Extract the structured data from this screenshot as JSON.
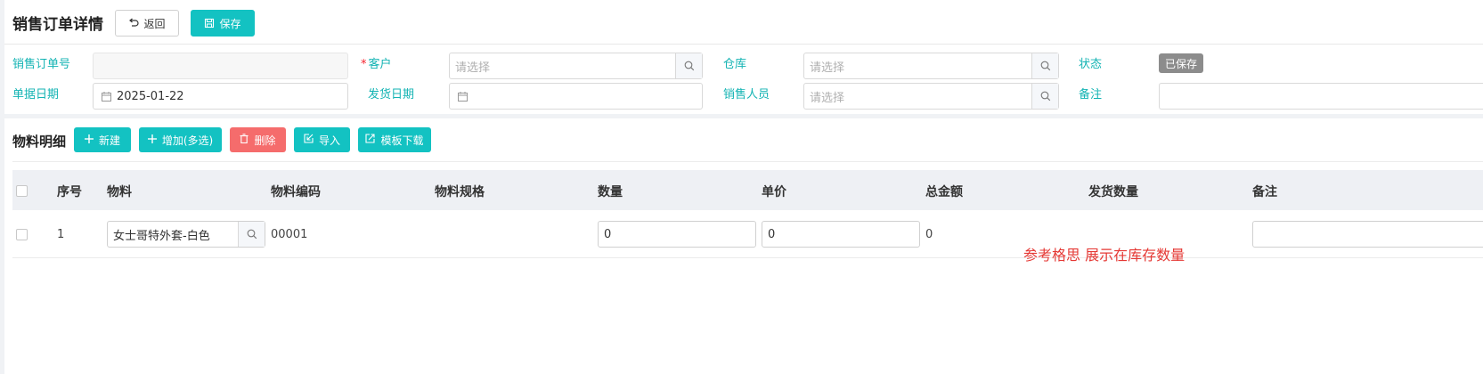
{
  "header": {
    "title": "销售订单详情",
    "back_label": "返回",
    "save_label": "保存"
  },
  "form": {
    "order_no": {
      "label": "销售订单号",
      "value": ""
    },
    "customer": {
      "label": "客户",
      "required_mark": "*",
      "placeholder": "请选择"
    },
    "warehouse": {
      "label": "仓库",
      "placeholder": "请选择"
    },
    "status": {
      "label": "状态",
      "value": "已保存"
    },
    "doc_date": {
      "label": "单据日期",
      "value": "2025-01-22"
    },
    "ship_date": {
      "label": "发货日期",
      "value": ""
    },
    "salesperson": {
      "label": "销售人员",
      "placeholder": "请选择"
    },
    "remark": {
      "label": "备注",
      "value": ""
    }
  },
  "details": {
    "title": "物料明细",
    "buttons": {
      "new": "新建",
      "add_multi": "增加(多选)",
      "delete": "删除",
      "import": "导入",
      "template_download": "模板下载"
    },
    "columns": {
      "seq": "序号",
      "material": "物料",
      "code": "物料编码",
      "spec": "物料规格",
      "qty": "数量",
      "price": "单价",
      "total": "总金额",
      "ship_qty": "发货数量",
      "remark": "备注"
    },
    "rows": [
      {
        "seq": "1",
        "material": "女士哥特外套-白色",
        "code": "00001",
        "spec": "",
        "qty": "0",
        "price": "0",
        "total": "0",
        "ship_qty": "",
        "remark": ""
      }
    ]
  },
  "annotation": "参考格思 展示在库存数量",
  "colors": {
    "primary": "#13c2c2",
    "danger": "#f56c6c",
    "status_badge": "#8c8c8c",
    "note": "#e53935"
  }
}
